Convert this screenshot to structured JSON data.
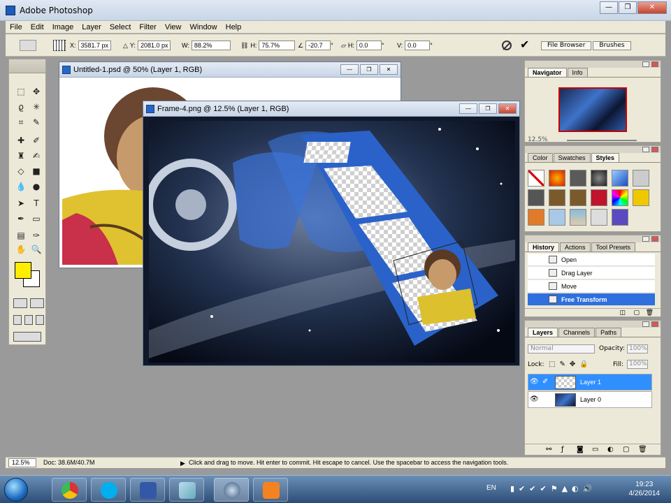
{
  "app": {
    "title": "Adobe Photoshop"
  },
  "menu": [
    "File",
    "Edit",
    "Image",
    "Layer",
    "Select",
    "Filter",
    "View",
    "Window",
    "Help"
  ],
  "options": {
    "x_label": "X:",
    "x_value": "3581.7 px",
    "y_label": "Y:",
    "y_value": "2081.0 px",
    "w_label": "W:",
    "w_value": "88.2%",
    "h_label": "H:",
    "h_value": "75.7%",
    "angle_value": "-20.7",
    "skew_h_label": "H:",
    "skew_h_value": "0.0",
    "skew_v_label": "V:",
    "skew_v_value": "0.0",
    "degree_sign": "°",
    "file_browser": "File Browser",
    "brushes": "Brushes"
  },
  "documents": [
    {
      "title": "Untitled-1.psd @ 50% (Layer 1, RGB)"
    },
    {
      "title": "Frame-4.png @ 12.5% (Layer 1, RGB)"
    }
  ],
  "colors": {
    "foreground": "#ffee00",
    "background": "#ffffff",
    "selection": "#2f6fde"
  },
  "navigator": {
    "tabs": [
      "Navigator",
      "Info"
    ],
    "zoom": "12.5%"
  },
  "styles_panel": {
    "tabs": [
      "Color",
      "Swatches",
      "Styles"
    ]
  },
  "history": {
    "tabs": [
      "History",
      "Actions",
      "Tool Presets"
    ],
    "items": [
      "Open",
      "Drag Layer",
      "Move",
      "Free Transform"
    ]
  },
  "layers": {
    "tabs": [
      "Layers",
      "Channels",
      "Paths"
    ],
    "blend_mode": "Normal",
    "opacity_label": "Opacity:",
    "opacity_value": "100%",
    "lock_label": "Lock:",
    "fill_label": "Fill:",
    "fill_value": "100%",
    "items": [
      "Layer 1",
      "Layer 0"
    ]
  },
  "status": {
    "zoom": "12.5%",
    "doc": "Doc: 38.6M/40.7M",
    "hint": "Click and drag to move. Hit enter to commit. Hit escape to cancel. Use the spacebar to access the navigation tools."
  },
  "taskbar": {
    "language": "EN",
    "time": "19:23",
    "date": "4/26/2014"
  }
}
